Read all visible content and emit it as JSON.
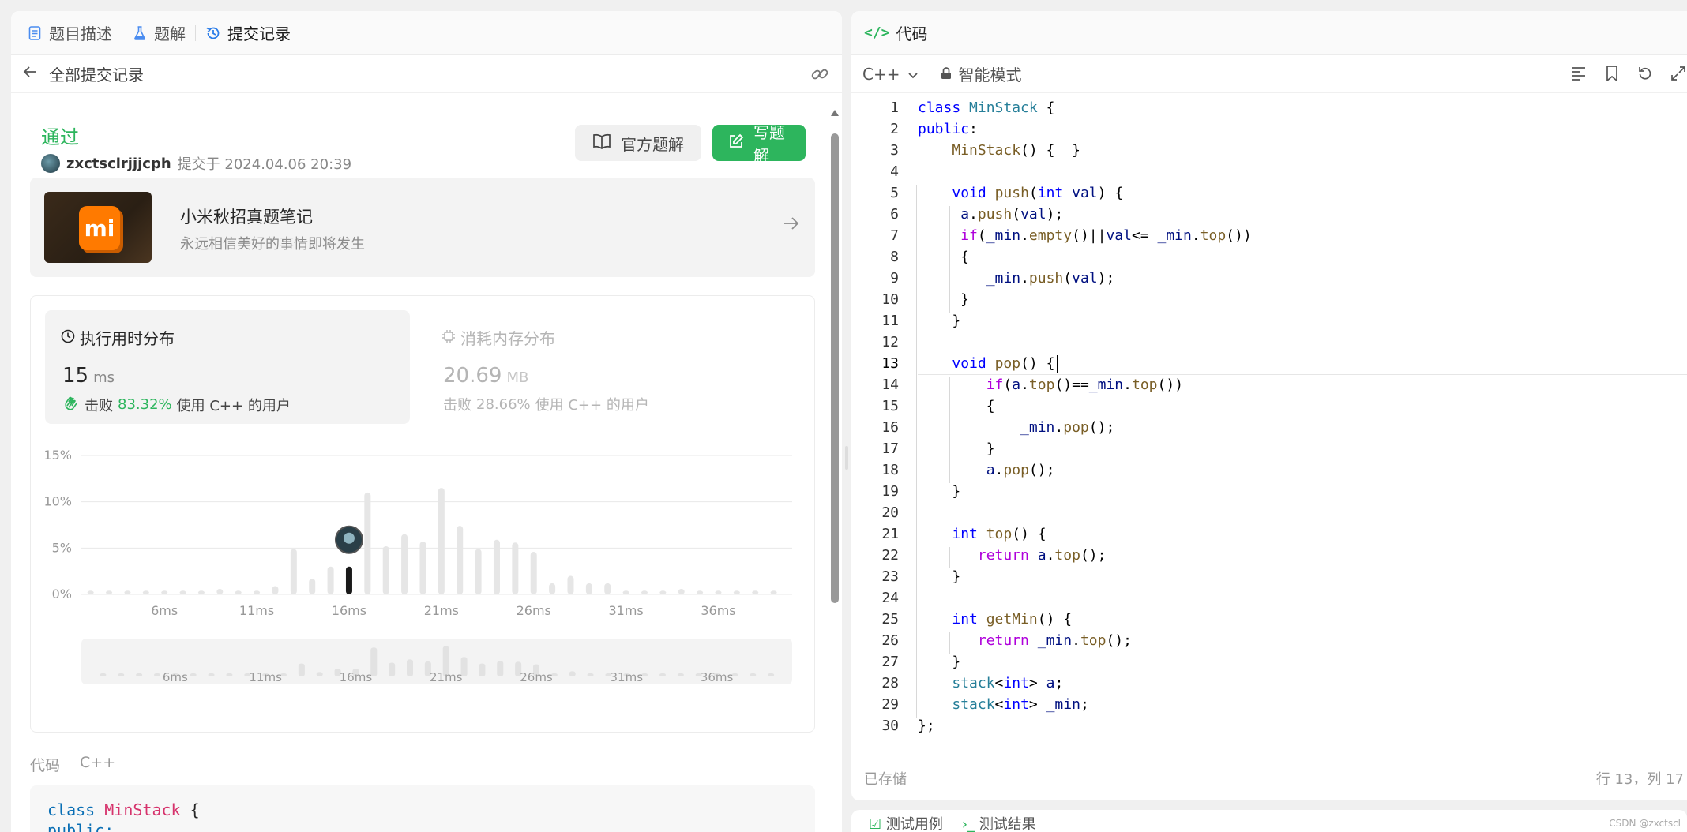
{
  "left_tabs": {
    "description": "题目描述",
    "solution": "题解",
    "submissions": "提交记录"
  },
  "back_bar": {
    "title": "全部提交记录"
  },
  "submission": {
    "status": "通过",
    "user": "zxctsclrjjjcph",
    "submitted_at": "提交于 2024.04.06 20:39"
  },
  "buttons": {
    "official": "官方题解",
    "write": "写题解"
  },
  "banner": {
    "title": "小米秋招真题笔记",
    "subtitle": "永远相信美好的事情即将发生",
    "logo_text": "mi"
  },
  "runtime": {
    "title": "执行用时分布",
    "value": "15",
    "unit": "ms",
    "beat_prefix": "击败",
    "beat_pct": "83.32%",
    "beat_suffix": "使用 C++ 的用户"
  },
  "memory": {
    "title": "消耗内存分布",
    "value": "20.69",
    "unit": "MB",
    "beat_prefix": "击败",
    "beat_pct": "28.66%",
    "beat_suffix": "使用 C++ 的用户"
  },
  "chart_data": {
    "type": "bar",
    "title": "",
    "y_ticks": [
      "0%",
      "5%",
      "10%",
      "15%"
    ],
    "ylim": [
      0,
      15
    ],
    "x_ticks": [
      "6ms",
      "11ms",
      "16ms",
      "21ms",
      "26ms",
      "31ms",
      "36ms"
    ],
    "x": [
      2,
      3,
      4,
      5,
      6,
      7,
      8,
      9,
      10,
      11,
      12,
      13,
      14,
      15,
      16,
      17,
      18,
      19,
      20,
      21,
      22,
      23,
      24,
      25,
      26,
      27,
      28,
      29,
      30,
      31,
      32,
      33,
      34,
      35,
      36,
      37,
      38,
      39
    ],
    "values": [
      0.4,
      0.4,
      0.4,
      0.4,
      0.4,
      0.4,
      0.4,
      0.6,
      0.4,
      0.4,
      0.9,
      4.9,
      1.7,
      3.0,
      3.0,
      11.0,
      5.2,
      6.5,
      5.7,
      11.5,
      7.4,
      4.9,
      5.9,
      5.6,
      4.6,
      1.2,
      2.0,
      1.2,
      1.2,
      0.4,
      0.4,
      0.4,
      0.6,
      0.4,
      0.4,
      0.4,
      0.4,
      0.4
    ],
    "highlight_x": 16,
    "grid": true
  },
  "code_info": {
    "label": "代码",
    "lang": "C++"
  },
  "code_preview": [
    "class MinStack {",
    "public:"
  ],
  "right_header": {
    "title": "代码"
  },
  "editor_bar": {
    "lang": "C++",
    "mode": "智能模式"
  },
  "editor": {
    "current_line": 13,
    "lines": [
      "class MinStack {",
      "public:",
      "    MinStack() {  }",
      "",
      "    void push(int val) {",
      "     a.push(val);",
      "     if(_min.empty()||val<= _min.top())",
      "     {",
      "        _min.push(val);",
      "     }",
      "    }",
      "",
      "    void pop() {",
      "        if(a.top()==_min.top())",
      "        {",
      "            _min.pop();",
      "        }",
      "        a.pop();",
      "    }",
      "",
      "    int top() {",
      "       return a.top();",
      "    }",
      "",
      "    int getMin() {",
      "       return _min.top();",
      "    }",
      "    stack<int> a;",
      "    stack<int> _min;",
      "};"
    ]
  },
  "footer": {
    "saved": "已存储",
    "position": "行 13，列 17"
  },
  "bottom_tabs": {
    "testcase": "测试用例",
    "result": "测试结果"
  },
  "watermark": "CSDN @zxctscl",
  "colors": {
    "accent": "#2db55d",
    "bar": "#e6e6e6",
    "highlight_bar": "#1a1a1a"
  }
}
